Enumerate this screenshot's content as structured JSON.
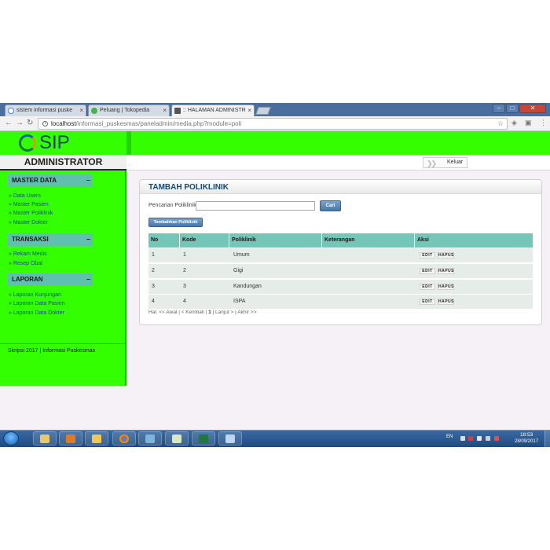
{
  "browser": {
    "tabs": [
      {
        "label": "sistem informasi puske",
        "favicon": "google-favicon",
        "active": false
      },
      {
        "label": "Peluang | Tokopedia",
        "favicon": "tokopedia-favicon",
        "active": false
      },
      {
        "label": ":: HALAMAN ADMINISTR",
        "favicon": "page-favicon",
        "active": true
      }
    ],
    "tab_close": "×",
    "address": {
      "host": "localhost",
      "path": "/informasi_puskesmas/paneladmin/media.php?module=poli"
    },
    "window_buttons": {
      "minimize": "–",
      "maximize": "□",
      "close": "✕"
    }
  },
  "header": {
    "logo_text": "SIP",
    "admin_title": "ADMINISTRATOR",
    "logout_label": "Keluar"
  },
  "sidebar": {
    "sections": [
      {
        "title": "MASTER DATA",
        "items": [
          "Data Users",
          "Master Pasien",
          "Master Poliklinik",
          "Master Dokter"
        ]
      },
      {
        "title": "TRANSAKSI",
        "items": [
          "Rekam Medis",
          "Resep Obat"
        ]
      },
      {
        "title": "LAPORAN",
        "items": [
          "Laporan Kunjungan",
          "Laporan Data Pasien",
          "Laporan Data Dokter"
        ]
      }
    ],
    "collapse_symbol": "–",
    "footer": "Skripsi 2017 | Informasi Puskesmas"
  },
  "panel": {
    "title": "TAMBAH POLIKLINIK",
    "search_label": "Pencarian Poliklinik:",
    "search_value": "",
    "search_button": "Cari",
    "add_button": "Tambahkan Poliklinik",
    "columns": [
      "No",
      "Kode",
      "Poliklinik",
      "Keterangan",
      "Aksi"
    ],
    "rows": [
      {
        "no": "1",
        "kode": "1",
        "poliklinik": "Umum",
        "keterangan": ""
      },
      {
        "no": "2",
        "kode": "2",
        "poliklinik": "Gigi",
        "keterangan": ""
      },
      {
        "no": "3",
        "kode": "3",
        "poliklinik": "Kandungan",
        "keterangan": ""
      },
      {
        "no": "4",
        "kode": "4",
        "poliklinik": "ISPA",
        "keterangan": ""
      }
    ],
    "edit_label": "EDIT",
    "delete_label": "HAPUS",
    "pager": {
      "prefix": "Hal:",
      "first": "<< Awal",
      "prev": "< Kembali",
      "current": "1",
      "next": "Lanjut >",
      "last": "Akhir >>"
    }
  },
  "taskbar": {
    "apps": [
      "file-explorer-icon",
      "media-player-icon",
      "folder-icon",
      "chrome-icon",
      "books-icon",
      "notepad-icon",
      "excel-icon",
      "remote-desktop-icon"
    ],
    "language": "EN",
    "time": "18:53",
    "date": "28/09/2017"
  },
  "colors": {
    "header_green": "#33ff00",
    "table_header": "#74c6b6",
    "section_head": "#5ec0ad",
    "title_blue": "#14496c"
  }
}
